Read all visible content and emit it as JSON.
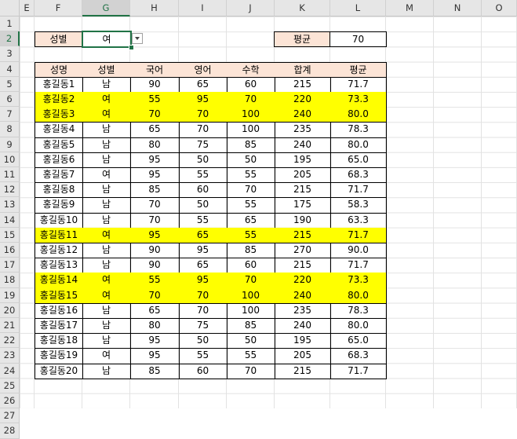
{
  "columns": [
    "E",
    "F",
    "G",
    "H",
    "I",
    "J",
    "K",
    "L",
    "M",
    "N",
    "O"
  ],
  "rows": [
    "1",
    "2",
    "3",
    "4",
    "5",
    "6",
    "7",
    "8",
    "9",
    "10",
    "11",
    "12",
    "13",
    "14",
    "15",
    "16",
    "17",
    "18",
    "19",
    "20",
    "21",
    "22",
    "23",
    "24",
    "25",
    "26",
    "27",
    "28"
  ],
  "filter": {
    "label": "성별",
    "value": "여"
  },
  "average": {
    "label": "평균",
    "value": "70"
  },
  "table": {
    "headers": [
      "성명",
      "성별",
      "국어",
      "영어",
      "수학",
      "합계",
      "평균"
    ],
    "rows": [
      [
        "홍길동1",
        "남",
        "90",
        "65",
        "60",
        "215",
        "71.7"
      ],
      [
        "홍길동2",
        "여",
        "55",
        "95",
        "70",
        "220",
        "73.3"
      ],
      [
        "홍길동3",
        "여",
        "70",
        "70",
        "100",
        "240",
        "80.0"
      ],
      [
        "홍길동4",
        "남",
        "65",
        "70",
        "100",
        "235",
        "78.3"
      ],
      [
        "홍길동5",
        "남",
        "80",
        "75",
        "85",
        "240",
        "80.0"
      ],
      [
        "홍길동6",
        "남",
        "95",
        "50",
        "50",
        "195",
        "65.0"
      ],
      [
        "홍길동7",
        "여",
        "95",
        "55",
        "55",
        "205",
        "68.3"
      ],
      [
        "홍길동8",
        "남",
        "85",
        "60",
        "70",
        "215",
        "71.7"
      ],
      [
        "홍길동9",
        "남",
        "70",
        "50",
        "55",
        "175",
        "58.3"
      ],
      [
        "홍길동10",
        "남",
        "70",
        "55",
        "65",
        "190",
        "63.3"
      ],
      [
        "홍길동11",
        "여",
        "95",
        "65",
        "55",
        "215",
        "71.7"
      ],
      [
        "홍길동12",
        "남",
        "90",
        "95",
        "85",
        "270",
        "90.0"
      ],
      [
        "홍길동13",
        "남",
        "90",
        "65",
        "60",
        "215",
        "71.7"
      ],
      [
        "홍길동14",
        "여",
        "55",
        "95",
        "70",
        "220",
        "73.3"
      ],
      [
        "홍길동15",
        "여",
        "70",
        "70",
        "100",
        "240",
        "80.0"
      ],
      [
        "홍길동16",
        "남",
        "65",
        "70",
        "100",
        "235",
        "78.3"
      ],
      [
        "홍길동17",
        "남",
        "80",
        "75",
        "85",
        "240",
        "80.0"
      ],
      [
        "홍길동18",
        "남",
        "95",
        "50",
        "50",
        "195",
        "65.0"
      ],
      [
        "홍길동19",
        "여",
        "95",
        "55",
        "55",
        "205",
        "68.3"
      ],
      [
        "홍길동20",
        "남",
        "85",
        "60",
        "70",
        "215",
        "71.7"
      ]
    ],
    "highlighted_rows": [
      1,
      2,
      10,
      13,
      14
    ]
  },
  "colors": {
    "header_fill": "#fce4d6",
    "highlight": "#ffff00",
    "selection": "#217346"
  },
  "icons": {
    "dropdown": "chevron-down-icon"
  }
}
